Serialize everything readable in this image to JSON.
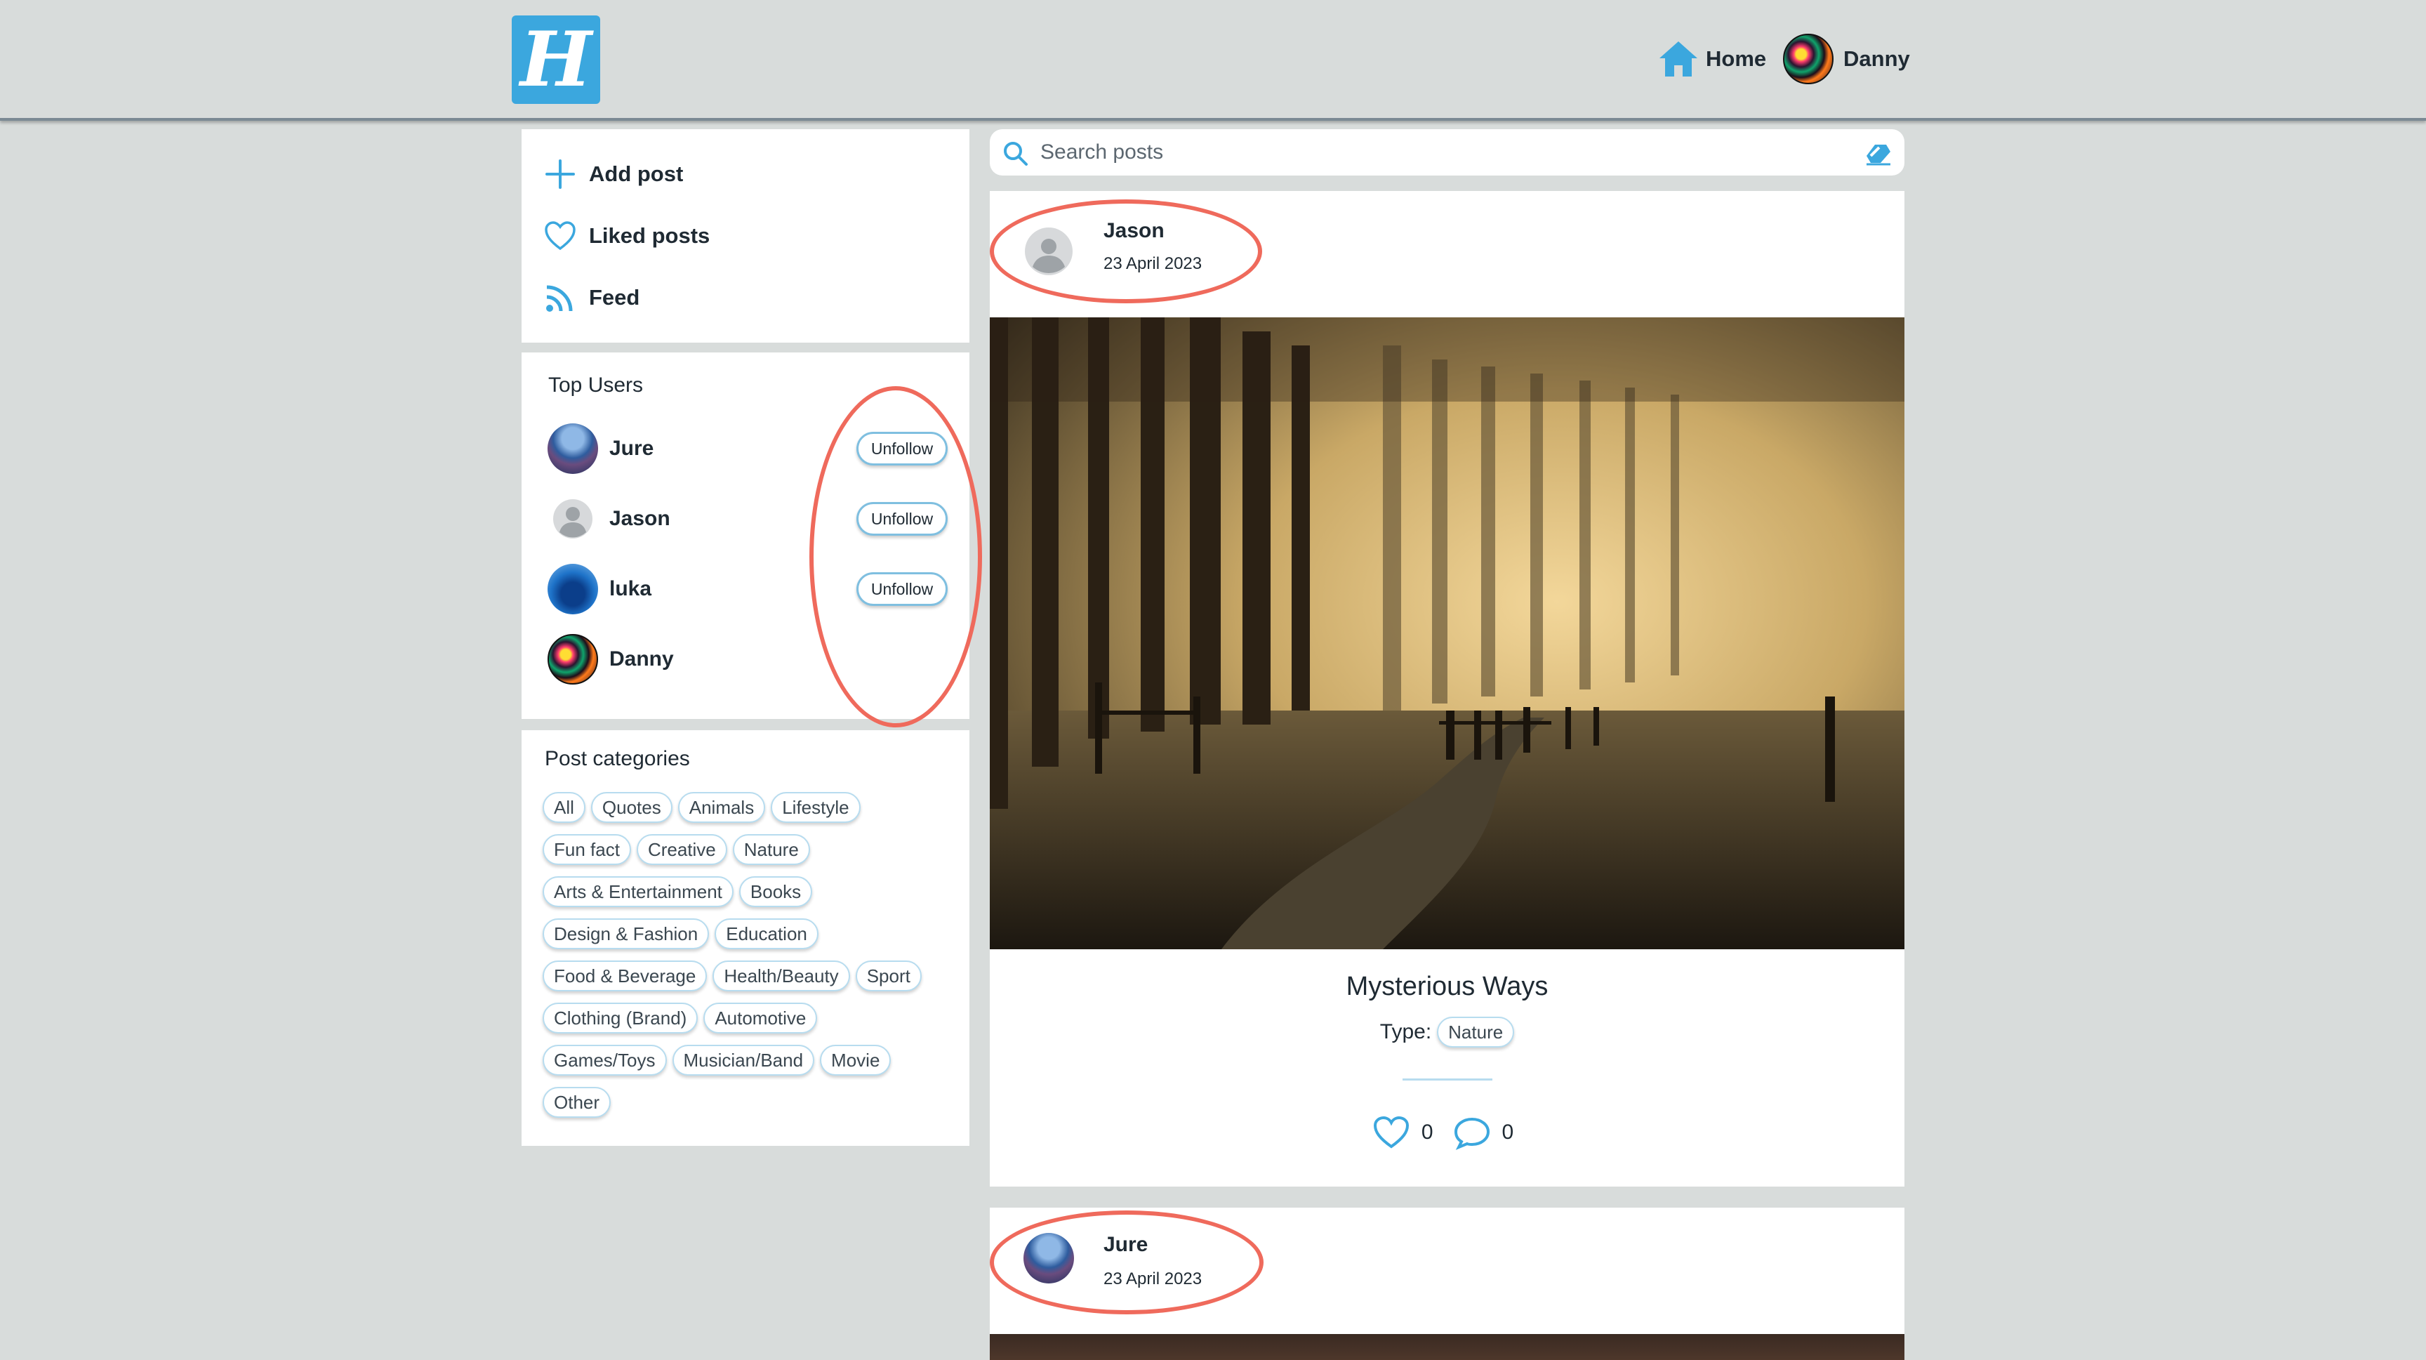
{
  "header": {
    "logo_letter": "H",
    "home_label": "Home",
    "user_name": "Danny"
  },
  "sidebar": {
    "menu": [
      {
        "label": "Add post",
        "icon": "plus-icon"
      },
      {
        "label": "Liked posts",
        "icon": "heart-icon"
      },
      {
        "label": "Feed",
        "icon": "rss-icon"
      }
    ],
    "top_users_title": "Top Users",
    "top_users": [
      {
        "name": "Jure",
        "button": "Unfollow"
      },
      {
        "name": "Jason",
        "button": "Unfollow"
      },
      {
        "name": "luka",
        "button": "Unfollow"
      },
      {
        "name": "Danny",
        "button": ""
      }
    ],
    "categories_title": "Post categories",
    "categories": [
      [
        "All",
        "Quotes",
        "Animals",
        "Lifestyle"
      ],
      [
        "Fun fact",
        "Creative",
        "Nature"
      ],
      [
        "Arts & Entertainment",
        "Books"
      ],
      [
        "Design & Fashion",
        "Education"
      ],
      [
        "Food & Beverage",
        "Health/Beauty",
        "Sport"
      ],
      [
        "Clothing (Brand)",
        "Automotive"
      ],
      [
        "Games/Toys",
        "Musician/Band",
        "Movie"
      ],
      [
        "Other"
      ]
    ]
  },
  "search": {
    "placeholder": "Search posts",
    "value": ""
  },
  "posts": [
    {
      "author": "Jason",
      "date": "23 April 2023",
      "title": "Mysterious Ways",
      "type_label": "Type:",
      "type": "Nature",
      "likes": "0",
      "comments": "0"
    },
    {
      "author": "Jure",
      "date": "23 April 2023"
    }
  ],
  "colors": {
    "accent": "#3ba7de",
    "background": "#d8dcdb",
    "annotation": "#ef6a5c"
  }
}
